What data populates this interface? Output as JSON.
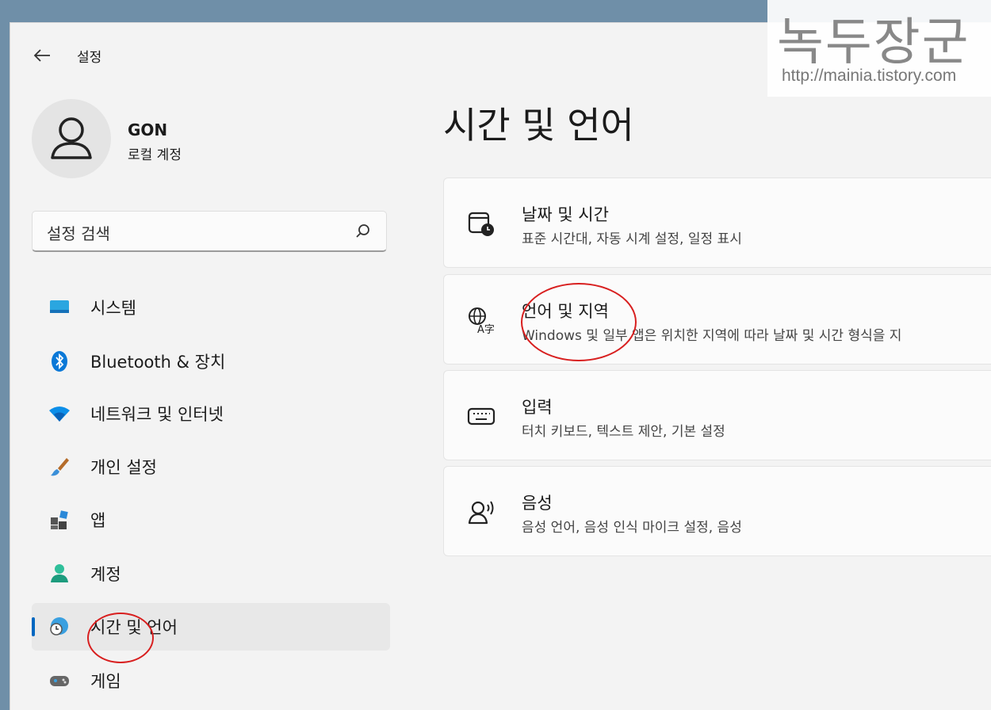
{
  "window": {
    "title": "설정"
  },
  "user": {
    "name": "GON",
    "account_type": "로컬 계정"
  },
  "search": {
    "placeholder": "설정 검색"
  },
  "sidebar": {
    "items": [
      {
        "label": "시스템",
        "icon": "system-icon"
      },
      {
        "label": "Bluetooth & 장치",
        "icon": "bluetooth-icon"
      },
      {
        "label": "네트워크 및 인터넷",
        "icon": "wifi-icon"
      },
      {
        "label": "개인 설정",
        "icon": "brush-icon"
      },
      {
        "label": "앱",
        "icon": "apps-icon"
      },
      {
        "label": "계정",
        "icon": "person-icon"
      },
      {
        "label": "시간 및 언어",
        "icon": "globe-clock-icon",
        "selected": true
      },
      {
        "label": "게임",
        "icon": "gamepad-icon"
      }
    ]
  },
  "main": {
    "title": "시간 및 언어",
    "cards": [
      {
        "title": "날짜 및 시간",
        "desc": "표준 시간대, 자동 시계 설정, 일정 표시",
        "icon": "calendar-clock-icon"
      },
      {
        "title": "언어 및 지역",
        "desc": "Windows 및 일부 앱은 위치한 지역에 따라 날짜 및 시간 형식을 지",
        "icon": "language-icon"
      },
      {
        "title": "입력",
        "desc": "터치 키보드, 텍스트 제안, 기본 설정",
        "icon": "keyboard-icon"
      },
      {
        "title": "음성",
        "desc": "음성 언어, 음성 인식 마이크 설정, 음성",
        "icon": "speech-icon"
      }
    ]
  },
  "watermark": {
    "title": "녹두장군",
    "url": "http://mainia.tistory.com"
  },
  "colors": {
    "accent": "#0067c0",
    "annotation": "#d81f1f"
  }
}
